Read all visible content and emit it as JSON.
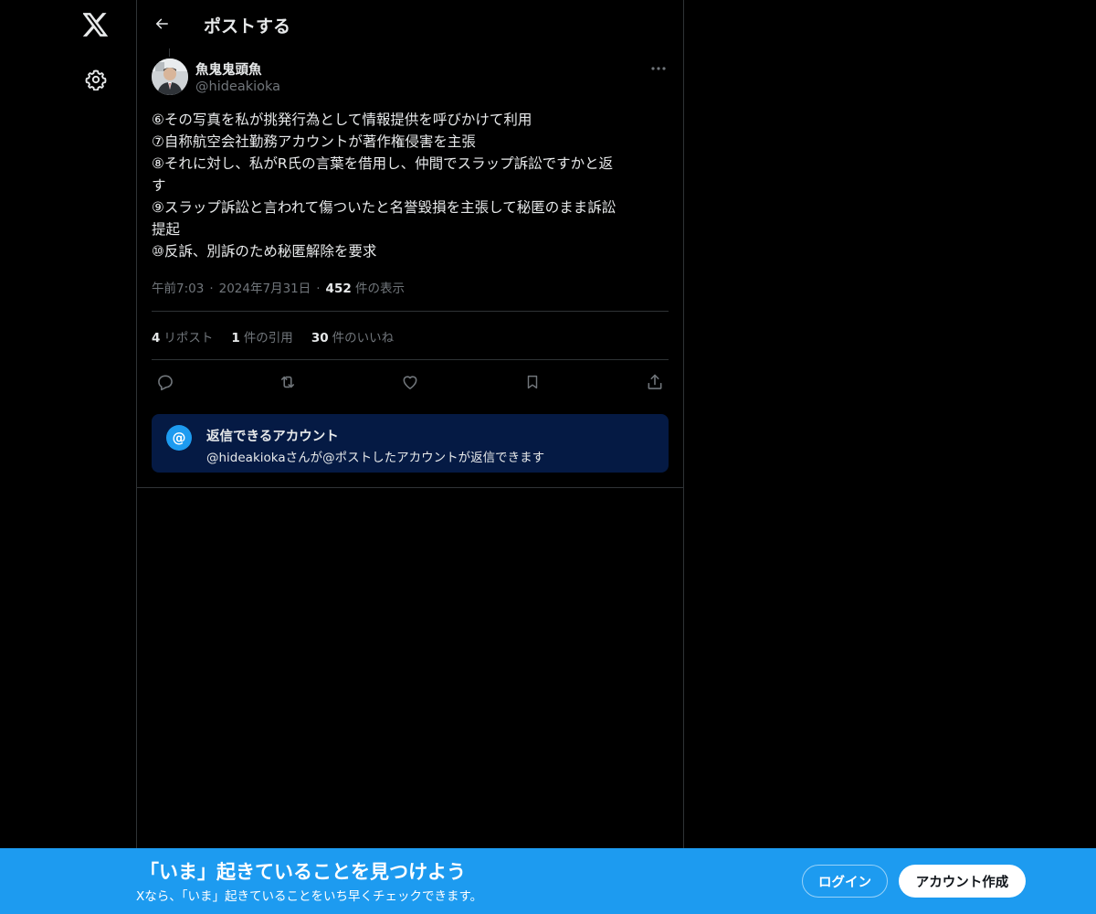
{
  "nav": {
    "logo_icon": "x-logo-icon",
    "settings_icon": "gear-icon"
  },
  "header": {
    "back_icon": "arrow-left-icon",
    "title": "ポストする"
  },
  "post": {
    "author_name": "魚鬼鬼頭魚",
    "author_handle": "@hideakioka",
    "more_icon": "more-dots-icon",
    "lines": [
      "⑥その写真を私が挑発行為として情報提供を呼びかけて利用",
      "⑦自称航空会社勤務アカウントが著作権侵害を主張",
      "⑧それに対し、私がR氏の言葉を借用し、仲間でスラップ訴訟ですかと返",
      "す",
      "⑨スラップ訴訟と言われて傷ついたと名誉毀損を主張して秘匿のまま訴訟",
      "提起",
      "⑩反訴、別訴のため秘匿解除を要求"
    ],
    "time": "午前7:03",
    "date": "2024年7月31日",
    "views_count": "452",
    "views_label": "件の表示",
    "stats": {
      "reposts_count": "4",
      "reposts_label": "リポスト",
      "quotes_count": "1",
      "quotes_label": "件の引用",
      "likes_count": "30",
      "likes_label": "件のいいね"
    },
    "actions": [
      "reply-icon",
      "repost-icon",
      "like-icon",
      "bookmark-icon",
      "share-icon"
    ]
  },
  "reply_restriction": {
    "icon": "@",
    "title": "返信できるアカウント",
    "description": "@hideakiokaさんが@ポストしたアカウントが返信できます"
  },
  "banner": {
    "title": "「いま」起きていることを見つけよう",
    "subtitle": "Xなら、「いま」起きていることをいち早くチェックできます。",
    "login_label": "ログイン",
    "signup_label": "アカウント作成"
  },
  "colors": {
    "background": "#000000",
    "text": "#e7e9ea",
    "muted": "#71767b",
    "border": "#2f3336",
    "accent": "#1d9bf0",
    "reply_box": "#051a44"
  }
}
